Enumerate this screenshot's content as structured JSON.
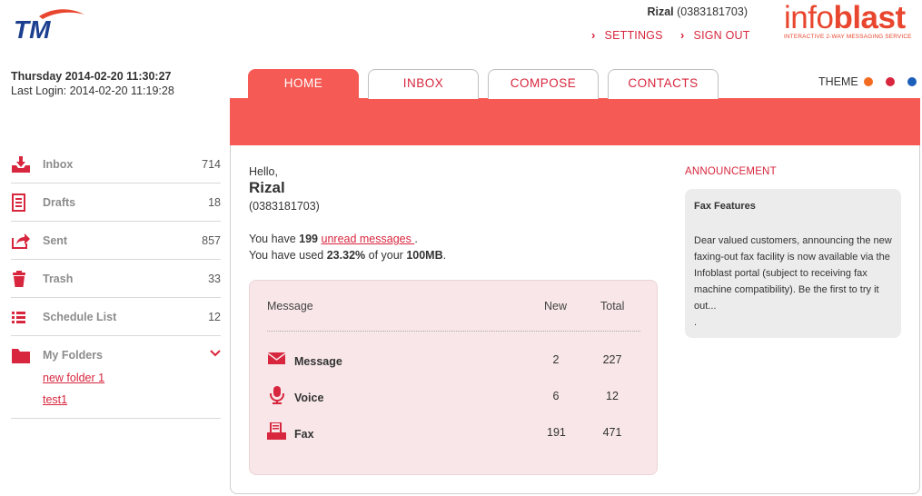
{
  "header": {
    "logo_text": "TM",
    "user_name": "Rizal",
    "user_phone": "(0383181703)",
    "settings_label": "SETTINGS",
    "signout_label": "SIGN OUT",
    "brand_part1": "info",
    "brand_part2": "blast",
    "brand_tagline": "INTERACTIVE 2-WAY MESSAGING SERVICE"
  },
  "session": {
    "datetime": "Thursday 2014-02-20 11:30:27",
    "last_login": "Last Login: 2014-02-20 11:19:28"
  },
  "sidebar": {
    "items": [
      {
        "label": "Inbox",
        "count": "714",
        "icon": "inbox-download-icon"
      },
      {
        "label": "Drafts",
        "count": "18",
        "icon": "document-icon"
      },
      {
        "label": "Sent",
        "count": "857",
        "icon": "share-icon"
      },
      {
        "label": "Trash",
        "count": "33",
        "icon": "trash-icon"
      },
      {
        "label": "Schedule List",
        "count": "12",
        "icon": "list-icon"
      }
    ],
    "folders_label": "My Folders",
    "folders": [
      "new folder 1",
      "test1"
    ]
  },
  "tabs": [
    {
      "label": "HOME",
      "active": true
    },
    {
      "label": "INBOX",
      "active": false
    },
    {
      "label": "COMPOSE",
      "active": false
    },
    {
      "label": "CONTACTS",
      "active": false
    }
  ],
  "theme": {
    "label": "THEME",
    "colors": [
      "#f26b21",
      "#d7263d",
      "#1c5fb8"
    ]
  },
  "welcome": {
    "hello": "Hello,",
    "name": "Rizal",
    "phone": "(0383181703)",
    "have_prefix": "You have ",
    "unread_count": "199",
    "unread_link": "unread messages ",
    "have_suffix": ".",
    "used_prefix": "You have used ",
    "used_percent": "23.32%",
    "used_mid": " of your ",
    "quota": "100MB",
    "used_suffix": "."
  },
  "summary": {
    "headers": {
      "message": "Message",
      "new": "New",
      "total": "Total"
    },
    "rows": [
      {
        "name": "Message",
        "new": "2",
        "total": "227",
        "icon": "envelope-icon"
      },
      {
        "name": "Voice",
        "new": "6",
        "total": "12",
        "icon": "microphone-icon"
      },
      {
        "name": "Fax",
        "new": "191",
        "total": "471",
        "icon": "fax-icon"
      }
    ]
  },
  "announcement": {
    "title": "ANNOUNCEMENT",
    "heading": "Fax Features",
    "body": "Dear valued customers, announcing the new faxing-out fax facility is now available via the Infoblast portal (subject to receiving fax machine compatibility). Be the first to try it out...",
    "trailer": "."
  },
  "colors": {
    "accent": "#d7263d",
    "band": "#f55a55",
    "brand": "#e8462e",
    "summary_bg": "#f8e6e8",
    "announcement_bg": "#ececec"
  }
}
